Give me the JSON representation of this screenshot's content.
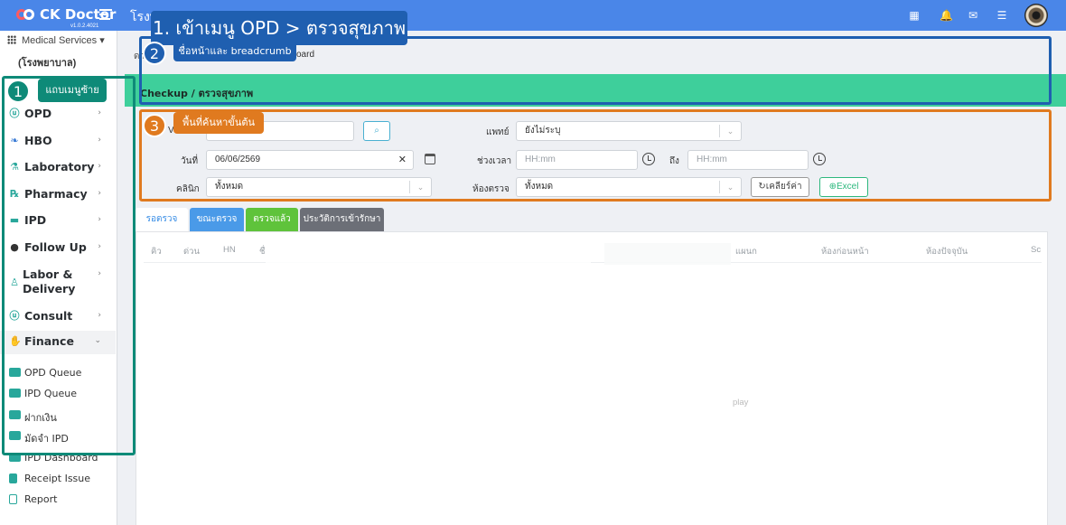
{
  "app": {
    "brand": "CK Doctor",
    "version": "v1.0.2.4021",
    "hospital_name": "โรงพ",
    "top_icons": [
      "grid-icon",
      "bell-icon",
      "mail-icon",
      "list-icon"
    ]
  },
  "sidebar": {
    "module_selector": "Medical Services",
    "hospital_short": "(โรงพยาบาล)",
    "items": [
      {
        "label": "OPD",
        "icon": "stethoscope-icon"
      },
      {
        "label": "HBO",
        "icon": "leaf-icon"
      },
      {
        "label": "Laboratory",
        "icon": "flask-icon"
      },
      {
        "label": "Pharmacy",
        "icon": "rx-icon"
      },
      {
        "label": "IPD",
        "icon": "bed-icon"
      },
      {
        "label": "Follow Up",
        "icon": "user-icon"
      },
      {
        "label": "Labor &",
        "label2": "Delivery",
        "icon": "baby-icon"
      },
      {
        "label": "Consult",
        "icon": "stethoscope-icon"
      },
      {
        "label": "Finance",
        "icon": "hand-money-icon"
      }
    ],
    "sub_items": [
      {
        "label": "OPD Queue"
      },
      {
        "label": "IPD Queue"
      },
      {
        "label": "ฝากเงิน"
      },
      {
        "label": "มัดจำ IPD"
      },
      {
        "label": "IPD Dashboard"
      },
      {
        "label": "Receipt Issue"
      },
      {
        "label": "Report"
      }
    ]
  },
  "breadcrumb": {
    "left": "ดา",
    "right": "oard"
  },
  "page_header": {
    "title": "Checkup / ตรวจสุขภาพ"
  },
  "filters": {
    "vn_label": "V",
    "vn_value": "",
    "doctor_label": "แพทย์",
    "doctor_value": "ยังไม่ระบุ",
    "date_label": "วันที่",
    "date_value": "06/06/2569",
    "time_label": "ช่วงเวลา",
    "time_from_placeholder": "HH:mm",
    "time_to_label": "ถึง",
    "time_to_placeholder": "HH:mm",
    "clinic_label": "คลินิก",
    "clinic_value": "ทั้งหมด",
    "room_label": "ห้องตรวจ",
    "room_value": "ทั้งหมด",
    "clear_label": "เคลียร์ค่า",
    "excel_label": "Excel"
  },
  "tabs": [
    {
      "label": "รอตรวจ",
      "color": "#ffffff"
    },
    {
      "label": "ขณะตรวจ",
      "color": "#4a9ae8"
    },
    {
      "label": "ตรวจแล้ว",
      "color": "#5fc33b"
    },
    {
      "label": "ประวัติการเข้ารักษา",
      "color": "#6c6f77"
    }
  ],
  "table": {
    "headers": [
      "คิว",
      "ด่วน",
      "HN",
      "ชื่",
      "แผนก",
      "ห้องก่อนหน้า",
      "ห้องปัจจุบัน",
      "Sc"
    ],
    "empty_text": "play"
  },
  "annotations": {
    "title": "1. เข้าเมนู OPD > ตรวจสุขภาพ",
    "n1": "1",
    "l1": "แถบเมนูซ้าย",
    "n2": "2",
    "l2": "ชื่อหน้าและ breadcrumb",
    "n3": "3",
    "l3": "พื้นที่ค้นหาขั้นต้น",
    "colors": {
      "teal": "#0e8a78",
      "blue": "#1f5fb0",
      "orange": "#e07a1f"
    }
  }
}
